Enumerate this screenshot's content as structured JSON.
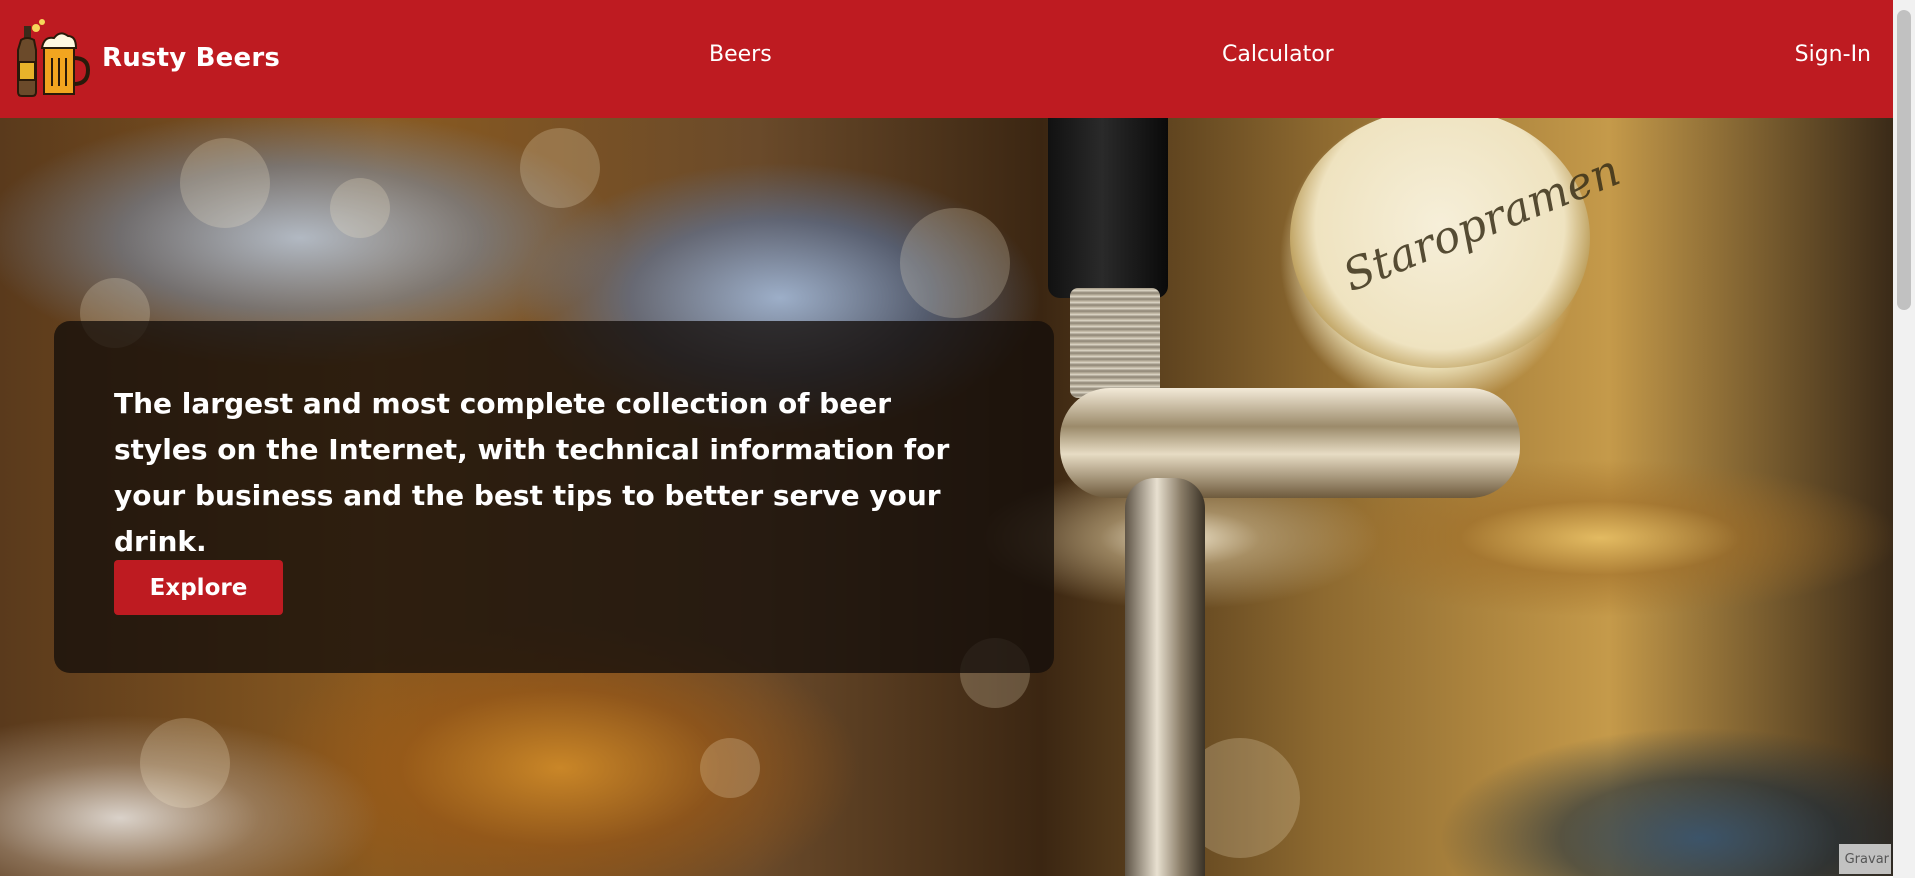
{
  "brand": {
    "name": "Rusty Beers",
    "logo_icon": "beer-bottle-and-mug-icon"
  },
  "nav": {
    "beers": "Beers",
    "calculator": "Calculator",
    "sign_in": "Sign-In"
  },
  "hero": {
    "headline": "The largest and most complete collection of beer styles on the Internet, with technical information for your business and the best tips to better serve your drink.",
    "cta_label": "Explore",
    "image_watermark": "Gravar"
  },
  "colors": {
    "brand_red": "#be1b21",
    "card_overlay": "#140e0a",
    "text_light": "#ffffff"
  }
}
